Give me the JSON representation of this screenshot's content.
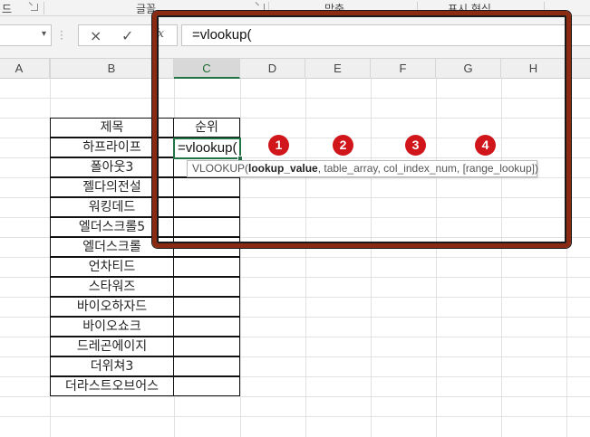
{
  "ribbon": {
    "left_label": "드",
    "groups": [
      "글꼴",
      "맞춤",
      "표시 형식"
    ]
  },
  "formula_bar": {
    "name_box": "",
    "cancel_icon": "×",
    "enter_icon": "✓",
    "fx_label": "fx",
    "formula": "=vlookup("
  },
  "columns": [
    "A",
    "B",
    "C",
    "D",
    "E",
    "F",
    "G",
    "H"
  ],
  "active_column": "C",
  "table": {
    "header_b": "제목",
    "header_c": "순위",
    "titles": [
      "하프라이프",
      "폴아웃3",
      "젤다의전설",
      "워킹데드",
      "엘더스크롤5",
      "엘더스크롤",
      "언차티드",
      "스타워즈",
      "바이오하자드",
      "바이오쇼크",
      "드레곤에이지",
      "더위쳐3",
      "더라스트오브어스"
    ]
  },
  "active_cell": {
    "text": "=vlookup("
  },
  "tooltip": {
    "fn": "VLOOKUP(",
    "arg1": "lookup_value",
    "rest": ", table_array, col_index_num, [range_lookup])"
  },
  "badges": [
    "1",
    "2",
    "3",
    "4"
  ],
  "colors": {
    "accent_green": "#217346",
    "badge_red": "#d0161b",
    "frame_brown": "#8a2a12"
  }
}
